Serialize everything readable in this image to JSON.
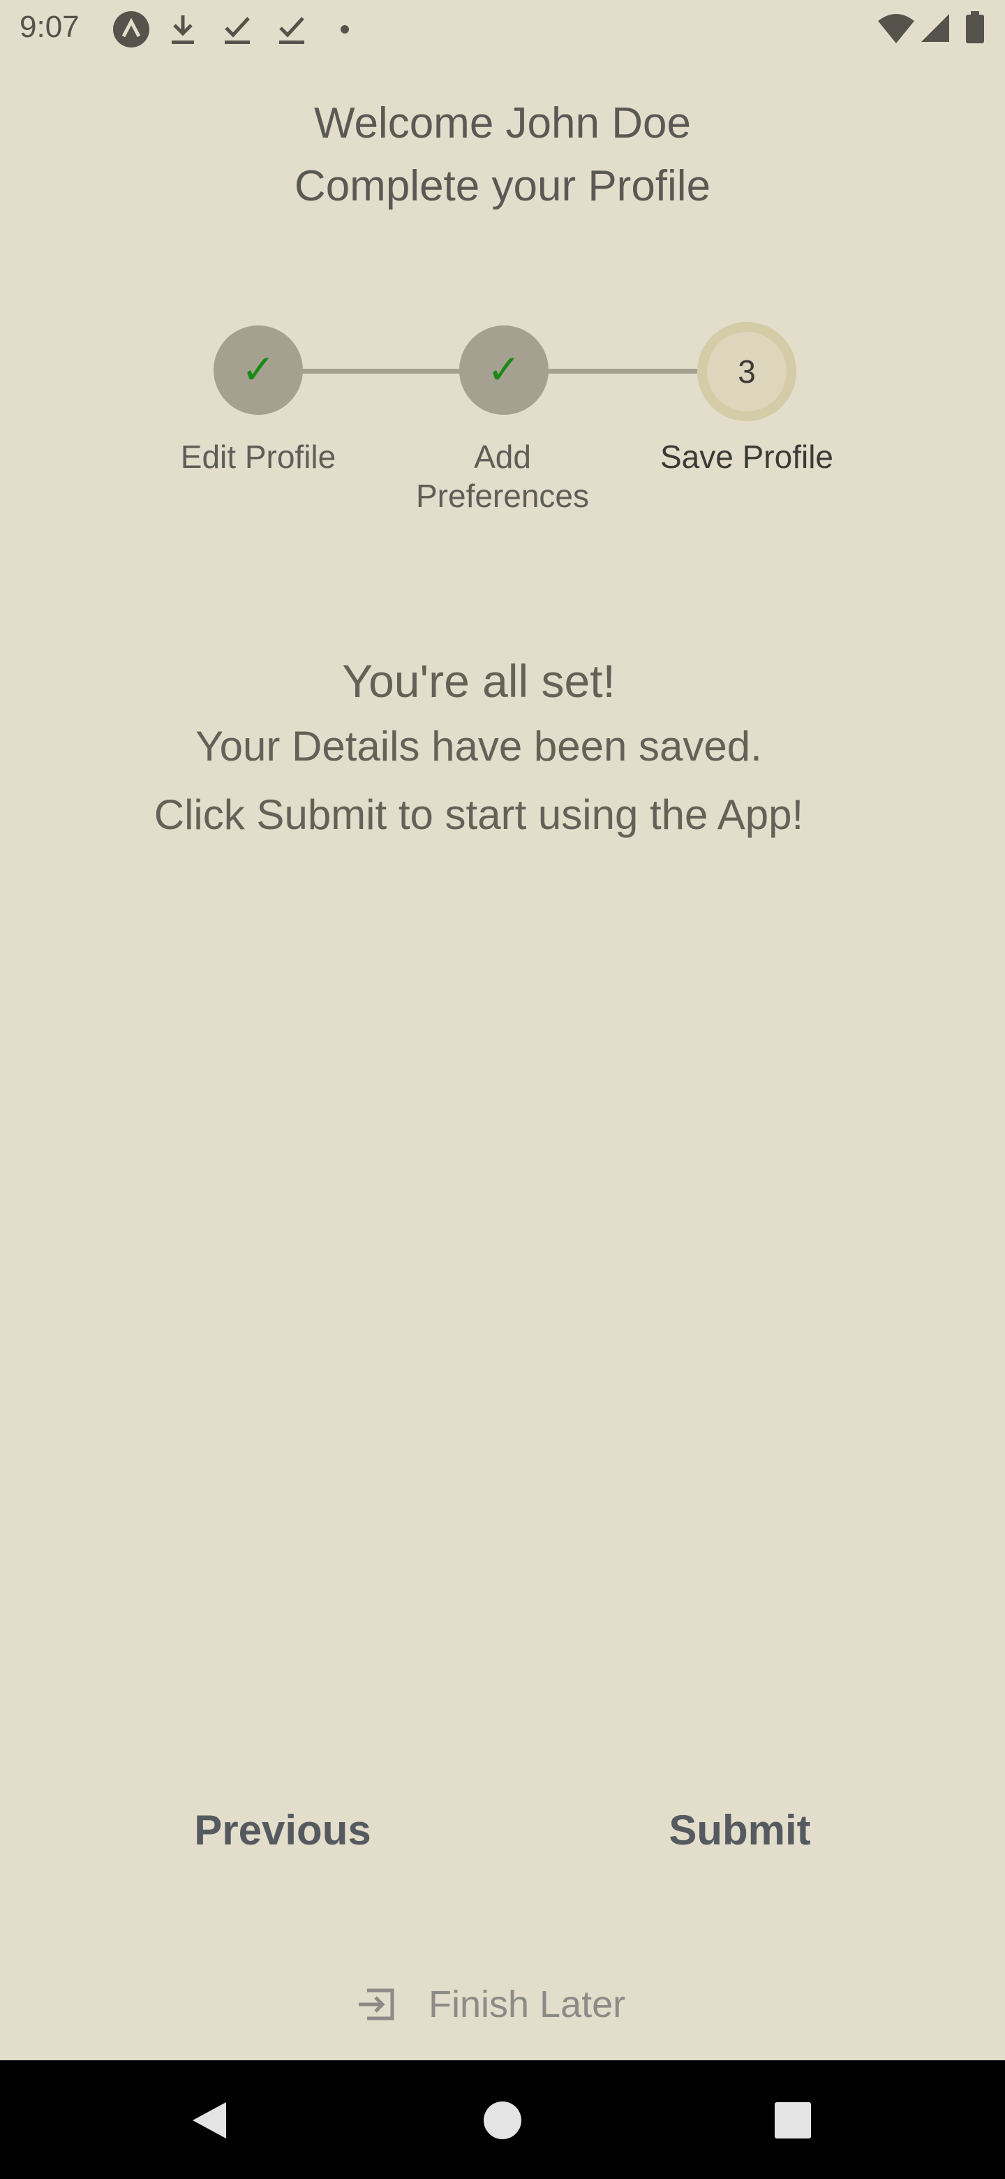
{
  "status_bar": {
    "time": "9:07",
    "icons": [
      "app-notification-icon",
      "download-icon",
      "download-done-icon",
      "download-done-icon",
      "dot-icon",
      "wifi-icon",
      "cell-signal-icon",
      "battery-icon"
    ]
  },
  "header": {
    "welcome": "Welcome John Doe",
    "subtitle": "Complete your Profile"
  },
  "stepper": {
    "steps": [
      {
        "label": "Edit Profile",
        "state": "completed",
        "icon": "check-icon"
      },
      {
        "label_line1": "Add",
        "label_line2": "Preferences",
        "state": "completed",
        "icon": "check-icon"
      },
      {
        "label": "Save Profile",
        "state": "active",
        "number": "3"
      }
    ],
    "colors": {
      "completed": "#a6a091",
      "active": "#ddd6bd",
      "check": "#1a8a16",
      "line": "#a6a091"
    }
  },
  "message": {
    "title": "You're all set!",
    "line1": "Your Details have been saved.",
    "line2": "Click Submit to start using the App!"
  },
  "actions": {
    "previous_label": "Previous",
    "submit_label": "Submit",
    "finish_later_label": "Finish Later",
    "finish_later_icon": "exit-to-app-icon"
  },
  "system_nav": {
    "buttons": [
      "back-icon",
      "home-icon",
      "recents-icon"
    ]
  },
  "theme": {
    "background": "#e3ddcb",
    "text": "#5d5a53",
    "button_text": "#555a60"
  }
}
